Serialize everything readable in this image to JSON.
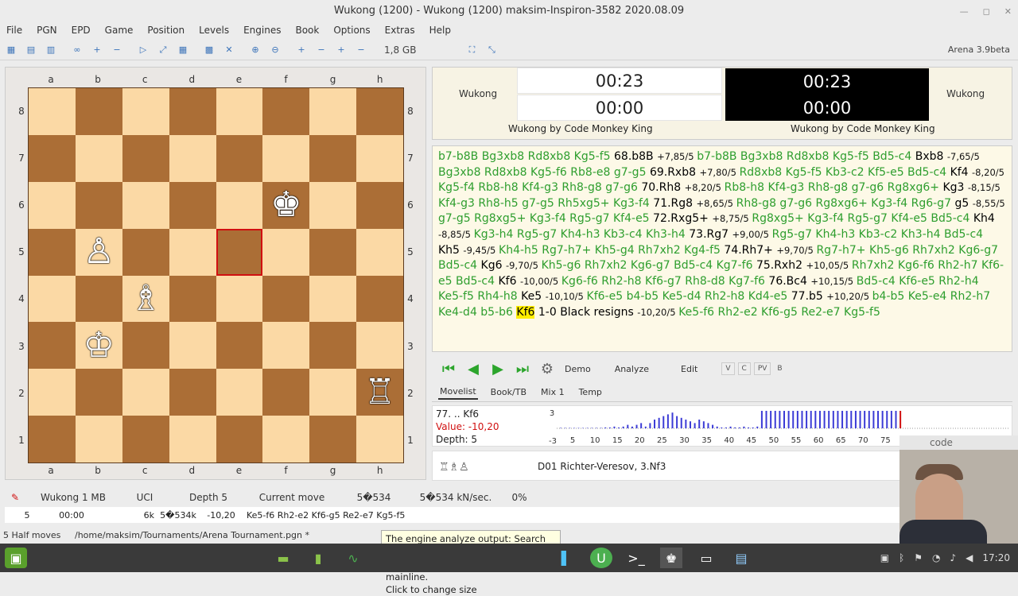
{
  "window": {
    "title": "Wukong (1200) - Wukong (1200)     maksim-Inspiron-3582     2020.08.09"
  },
  "menu": [
    "File",
    "PGN",
    "EPD",
    "Game",
    "Position",
    "Levels",
    "Engines",
    "Book",
    "Options",
    "Extras",
    "Help"
  ],
  "toolbar": {
    "memory": "1,8 GB",
    "version": "Arena 3.9beta"
  },
  "board": {
    "files": [
      "a",
      "b",
      "c",
      "d",
      "e",
      "f",
      "g",
      "h"
    ],
    "ranks": [
      "8",
      "7",
      "6",
      "5",
      "4",
      "3",
      "2",
      "1"
    ],
    "pieces": {
      "f6": "♚",
      "b5": "♙",
      "c4": "♗",
      "b3": "♔",
      "h2": "♖"
    },
    "highlighted": [
      "e5",
      "f6"
    ],
    "light_color": "#fbd9a5",
    "dark_color": "#ab6e36"
  },
  "clocks": {
    "white": {
      "name": "Wukong",
      "time_main": "00:23",
      "time_move": "00:00",
      "engine": "Wukong by Code Monkey King"
    },
    "black": {
      "name": "Wukong",
      "time_main": "00:23",
      "time_move": "00:00",
      "engine": "Wukong by Code Monkey King"
    }
  },
  "moves": [
    {
      "t": "pv",
      "s": "b7-b8B Bg3xb8 Rd8xb8 Kg5-f5 "
    },
    {
      "t": "mv",
      "s": "68.b8B "
    },
    {
      "t": "sc",
      "s": "+7,85/5 "
    },
    {
      "t": "pv",
      "s": " b7-b8B Bg3xb8 Rd8xb8 Kg5-f5 Bd5-c4 "
    },
    {
      "t": "mv",
      "s": "Bxb8 "
    },
    {
      "t": "sc",
      "s": "-7,65/5 "
    },
    {
      "t": "pv",
      "s": "Bg3xb8 Rd8xb8 Kg5-f6 Rb8-e8 g7-g5 "
    },
    {
      "t": "mv",
      "s": "69.Rxb8 "
    },
    {
      "t": "sc",
      "s": "+7,80/5 "
    },
    {
      "t": "pv",
      "s": " Rd8xb8 Kg5-f5 Kb3-c2 Kf5-e5 Bd5-c4 "
    },
    {
      "t": "mv",
      "s": "Kf4 "
    },
    {
      "t": "sc",
      "s": "-8,20/5 "
    },
    {
      "t": "pv",
      "s": " Kg5-f4 Rb8-h8 Kf4-g3 Rh8-g8 g7-g6 "
    },
    {
      "t": "mv",
      "s": "70.Rh8 "
    },
    {
      "t": "sc",
      "s": "+8,20/5 "
    },
    {
      "t": "pv",
      "s": " Rb8-h8 Kf4-g3 Rh8-g8 g7-g6 Rg8xg6+ "
    },
    {
      "t": "mv",
      "s": "Kg3 "
    },
    {
      "t": "sc",
      "s": "-8,15/5 "
    },
    {
      "t": "pv",
      "s": " Kf4-g3 Rh8-h5 g7-g5 Rh5xg5+ Kg3-f4 "
    },
    {
      "t": "mv",
      "s": "71.Rg8 "
    },
    {
      "t": "sc",
      "s": "+8,65/5 "
    },
    {
      "t": "pv",
      "s": "Rh8-g8 g7-g6 Rg8xg6+ Kg3-f4 Rg6-g7 "
    },
    {
      "t": "mv",
      "s": "g5 "
    },
    {
      "t": "sc",
      "s": "-8,55/5 "
    },
    {
      "t": "pv",
      "s": " g7-g5 Rg8xg5+ Kg3-f4 Rg5-g7 Kf4-e5 "
    },
    {
      "t": "mv",
      "s": "72.Rxg5+ "
    },
    {
      "t": "sc",
      "s": "+8,75/5 "
    },
    {
      "t": "pv",
      "s": " Rg8xg5+ Kg3-f4 Rg5-g7 Kf4-e5 Bd5-c4 "
    },
    {
      "t": "mv",
      "s": "Kh4 "
    },
    {
      "t": "sc",
      "s": "-8,85/5 "
    },
    {
      "t": "pv",
      "s": " Kg3-h4 Rg5-g7 Kh4-h3 Kb3-c4 Kh3-h4 "
    },
    {
      "t": "mv",
      "s": "73.Rg7 "
    },
    {
      "t": "sc",
      "s": "+9,00/5 "
    },
    {
      "t": "pv",
      "s": " Rg5-g7 Kh4-h3 Kb3-c2 Kh3-h4 Bd5-c4 "
    },
    {
      "t": "mv",
      "s": "Kh5 "
    },
    {
      "t": "sc",
      "s": "-9,45/5 "
    },
    {
      "t": "pv",
      "s": " Kh4-h5 Rg7-h7+ Kh5-g4 Rh7xh2 Kg4-f5 "
    },
    {
      "t": "mv",
      "s": "74.Rh7+ "
    },
    {
      "t": "sc",
      "s": "+9,70/5 "
    },
    {
      "t": "pv",
      "s": " Rg7-h7+ Kh5-g6 Rh7xh2 Kg6-g7 Bd5-c4 "
    },
    {
      "t": "mv",
      "s": "Kg6 "
    },
    {
      "t": "sc",
      "s": "-9,70/5 "
    },
    {
      "t": "pv",
      "s": " Kh5-g6 Rh7xh2 Kg6-g7 Bd5-c4 Kg7-f6 "
    },
    {
      "t": "mv",
      "s": "75.Rxh2 "
    },
    {
      "t": "sc",
      "s": "+10,05/5 "
    },
    {
      "t": "pv",
      "s": " Rh7xh2 Kg6-f6 Rh2-h7 Kf6-e5 Bd5-c4 "
    },
    {
      "t": "mv",
      "s": "Kf6 "
    },
    {
      "t": "sc",
      "s": "-10,00/5 "
    },
    {
      "t": "pv",
      "s": " Kg6-f6 Rh2-h8 Kf6-g7 Rh8-d8 Kg7-f6 "
    },
    {
      "t": "mv",
      "s": "76.Bc4 "
    },
    {
      "t": "sc",
      "s": "+10,15/5 "
    },
    {
      "t": "pv",
      "s": " Bd5-c4 Kf6-e5 Rh2-h4 Ke5-f5 Rh4-h8 "
    },
    {
      "t": "mv",
      "s": "Ke5 "
    },
    {
      "t": "sc",
      "s": "-10,10/5 "
    },
    {
      "t": "pv",
      "s": " Kf6-e5 b4-b5 Ke5-d4 Rh2-h8 Kd4-e5 "
    },
    {
      "t": "mv",
      "s": "77.b5 "
    },
    {
      "t": "sc",
      "s": "+10,20/5 "
    },
    {
      "t": "pv",
      "s": " b4-b5 Ke5-e4 Rh2-h7 Ke4-d4 b5-b6 "
    },
    {
      "t": "cur",
      "s": "Kf6"
    },
    {
      "t": "mv",
      "s": " 1-0 Black resigns "
    },
    {
      "t": "sc",
      "s": "-10,20/5 "
    },
    {
      "t": "pv",
      "s": " Ke5-f6 Rh2-e2 Kf6-g5 Re2-e7 Kg5-f5"
    }
  ],
  "controls": {
    "demo": "Demo",
    "analyze": "Analyze",
    "edit": "Edit",
    "small": [
      "V",
      "C",
      "PV",
      "B"
    ]
  },
  "tabs": [
    "Movelist",
    "Book/TB",
    "Mix 1",
    "Temp"
  ],
  "eval": {
    "move": "77. .. Kf6",
    "value": "Value: -10,20",
    "depth": "Depth: 5",
    "y_top": "3",
    "y_bottom": "-3",
    "x_ticks": [
      "5",
      "10",
      "15",
      "20",
      "25",
      "30",
      "35",
      "40",
      "45",
      "50",
      "55",
      "60",
      "65",
      "70",
      "75"
    ]
  },
  "opening": {
    "eco": "D01   Richter-Veresov, 3.Nf3"
  },
  "engine_header": {
    "name": "Wukong  1 MB",
    "proto": "UCI",
    "depth": "Depth 5",
    "current": "Current move",
    "nodes": "5�534",
    "speed": "5�534 kN/sec.",
    "percent": "0%"
  },
  "engine_row": {
    "depth": "5",
    "time": "00:00",
    "nodes": "6k",
    "nodes2": "5�534k",
    "value": "-10,20",
    "line": "Ke5-f6 Rh2-e2 Kf6-g5 Re2-e7 Kg5-f5"
  },
  "status": {
    "halfmoves": "5 Half moves",
    "path": "/home/maksim/Tournaments/Arena Tournament.pgn *"
  },
  "tooltip": {
    "line1": "The engine analyze output: Search depth,",
    "line2": "time, nodes, nodes/sec., value, mainline.",
    "line3": "Click to change size"
  },
  "webcam": {
    "title": "code"
  },
  "tray": {
    "clock": "17:20"
  },
  "eval_graph": {
    "type": "bar",
    "note_values": "negative evaluations dense after move 55",
    "values": [
      0,
      0,
      0,
      0,
      0,
      0,
      0,
      0,
      0,
      0,
      0.05,
      0.05,
      0.1,
      0.05,
      0.1,
      0.2,
      0.1,
      0.2,
      0.3,
      0.1,
      0.3,
      0.5,
      0.6,
      0.7,
      0.8,
      0.9,
      0.7,
      0.6,
      0.5,
      0.4,
      0.3,
      0.5,
      0.4,
      0.3,
      0.2,
      0.1,
      0.05,
      0.05,
      0.1,
      0.05,
      0.05,
      0.1,
      0.05,
      0.05,
      0.1,
      1,
      1,
      1,
      1,
      1,
      1,
      1,
      1,
      1,
      1,
      1,
      1,
      1,
      1,
      1,
      1,
      1,
      1,
      1,
      1,
      1,
      1,
      1,
      1,
      1,
      1,
      1,
      1,
      1,
      1,
      1,
      1
    ]
  }
}
